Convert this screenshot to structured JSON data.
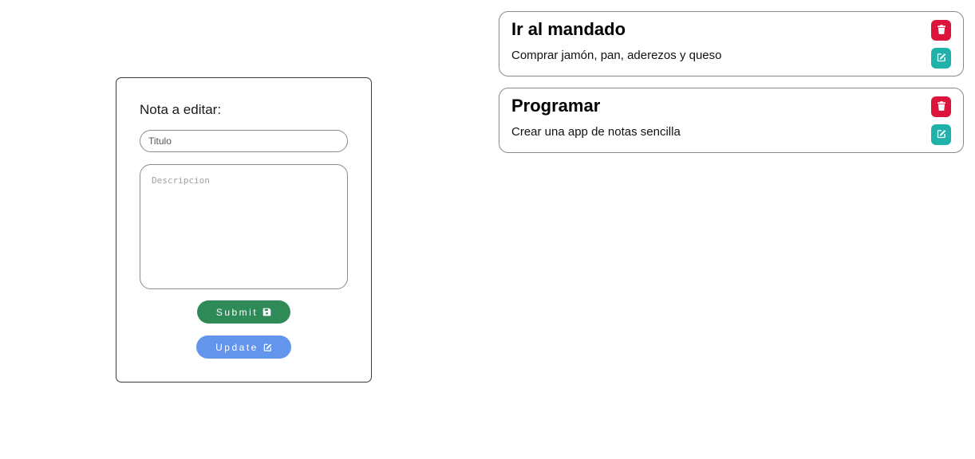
{
  "form": {
    "label": "Nota a editar:",
    "title_placeholder": "Titulo",
    "title_value": "",
    "description_placeholder": "Descripcion",
    "description_value": "",
    "submit_label": "Submit",
    "submit_icon": "save-icon",
    "update_label": "Update",
    "update_icon": "edit-icon",
    "colors": {
      "submit": "#2e8b57",
      "update": "#6495ed"
    }
  },
  "notes": [
    {
      "title": "Ir al mandado",
      "description": "Comprar jamón, pan, aderezos y queso"
    },
    {
      "title": "Programar",
      "description": "Crear una app de notas sencilla"
    }
  ],
  "note_actions": {
    "delete_icon": "trash-icon",
    "edit_icon": "edit-icon",
    "colors": {
      "delete": "#dc143c",
      "edit": "#20b2aa"
    }
  }
}
